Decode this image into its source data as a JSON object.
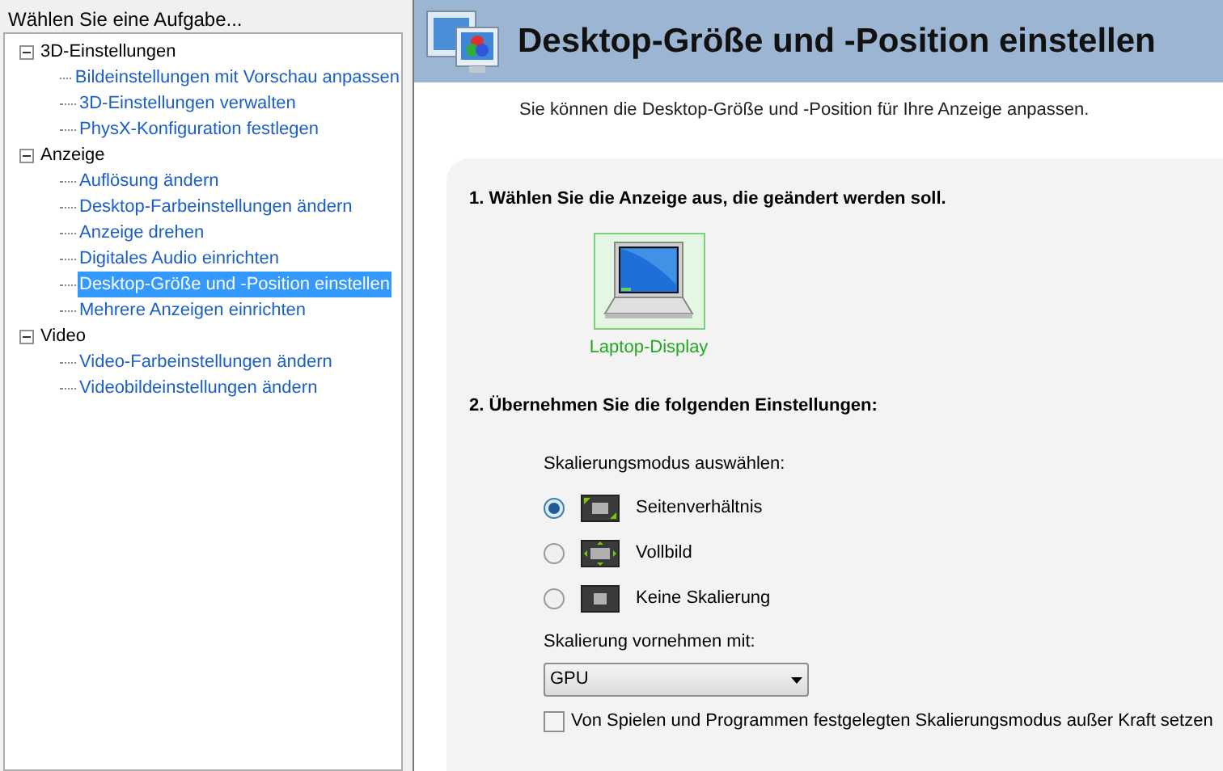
{
  "sidebar": {
    "title": "Wählen Sie eine Aufgabe...",
    "tree": [
      {
        "label": "3D-Einstellungen",
        "expanded": true,
        "children": [
          {
            "label": "Bildeinstellungen mit Vorschau anpassen",
            "selected": false
          },
          {
            "label": "3D-Einstellungen verwalten",
            "selected": false
          },
          {
            "label": "PhysX-Konfiguration festlegen",
            "selected": false
          }
        ]
      },
      {
        "label": "Anzeige",
        "expanded": true,
        "children": [
          {
            "label": "Auflösung ändern",
            "selected": false
          },
          {
            "label": "Desktop-Farbeinstellungen ändern",
            "selected": false
          },
          {
            "label": "Anzeige drehen",
            "selected": false
          },
          {
            "label": "Digitales Audio einrichten",
            "selected": false
          },
          {
            "label": "Desktop-Größe und -Position einstellen",
            "selected": true
          },
          {
            "label": "Mehrere Anzeigen einrichten",
            "selected": false
          }
        ]
      },
      {
        "label": "Video",
        "expanded": true,
        "children": [
          {
            "label": "Video-Farbeinstellungen ändern",
            "selected": false
          },
          {
            "label": "Videobildeinstellungen ändern",
            "selected": false
          }
        ]
      }
    ]
  },
  "page": {
    "title": "Desktop-Größe und -Position einstellen",
    "description": "Sie können die Desktop-Größe und -Position für Ihre Anzeige anpassen.",
    "step1": "1. Wählen Sie die Anzeige aus, die geändert werden soll.",
    "displays": [
      {
        "label": "Laptop-Display",
        "selected": true
      }
    ],
    "step2": "2. Übernehmen Sie die folgenden Einstellungen:",
    "mode_label": "Skalierungsmodus auswählen:",
    "modes": [
      {
        "label": "Seitenverhältnis",
        "kind": "aspect",
        "selected": true
      },
      {
        "label": "Vollbild",
        "kind": "full",
        "selected": false
      },
      {
        "label": "Keine Skalierung",
        "kind": "none",
        "selected": false
      }
    ],
    "perform_label": "Skalierung vornehmen mit:",
    "perform_value": "GPU",
    "override": {
      "label": "Von Spielen und Programmen festgelegten Skalierungsmodus außer Kraft setzen",
      "checked": false
    }
  }
}
